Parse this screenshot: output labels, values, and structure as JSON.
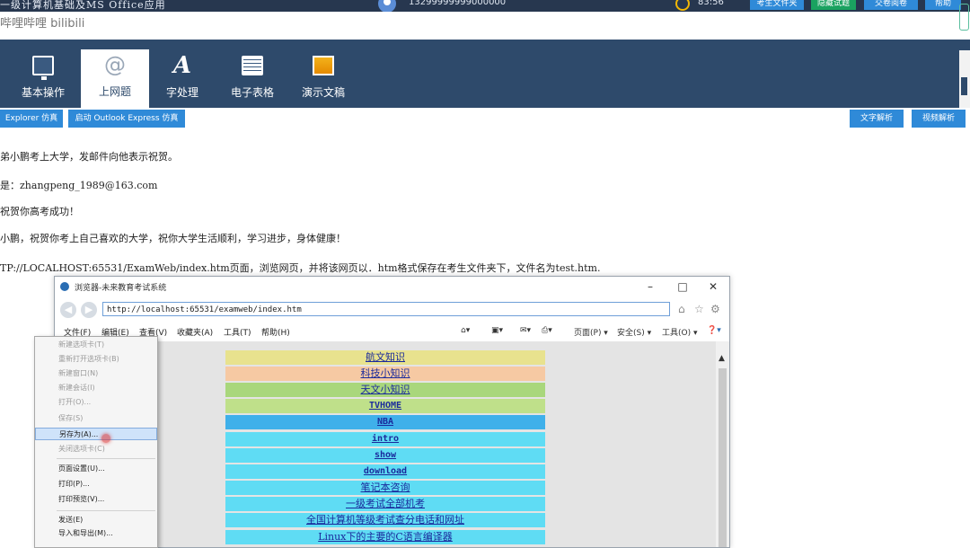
{
  "topbar": {
    "title": "一级计算机基础及MS Office应用",
    "phone": "13299999999000000",
    "time": "83:56",
    "buttons": [
      {
        "label": "考生文件夹",
        "color": "#2f8ad8"
      },
      {
        "label": "隐藏试题",
        "color": "#1aa260"
      },
      {
        "label": "交卷阅卷",
        "color": "#2f8ad8"
      },
      {
        "label": "帮助",
        "color": "#2f8ad8"
      }
    ]
  },
  "watermark": "哔哩哔哩 bilibili",
  "nav": {
    "items": [
      {
        "label": "基本操作",
        "icon": "monitor-icon"
      },
      {
        "label": "上网题",
        "icon": "at-icon",
        "glyph": "@"
      },
      {
        "label": "字处理",
        "icon": "text-a-icon",
        "glyph": "A"
      },
      {
        "label": "电子表格",
        "icon": "spreadsheet-icon"
      },
      {
        "label": "演示文稿",
        "icon": "presentation-icon"
      }
    ]
  },
  "actions": {
    "left": [
      "Explorer 仿真",
      "启动 Outlook Express 仿真"
    ],
    "right": [
      "文字解析",
      "视频解析"
    ]
  },
  "task": {
    "lines": [
      "弟小鹏考上大学，发邮件向他表示祝贺。",
      "是：zhangpeng_1989@163.com",
      "祝贺你高考成功！",
      "小鹏，祝贺你考上自己喜欢的大学，祝你大学生活顺利，学习进步，身体健康！",
      "TP://LOCALHOST:65531/ExamWeb/index.htm页面，浏览网页，并将该网页以．htm格式保存在考生文件夹下，文件名为test.htm."
    ]
  },
  "browser": {
    "title": "浏览器-未来教育考试系统",
    "url": "http://localhost:65531/examweb/index.htm",
    "menu": [
      "文件(F)",
      "编辑(E)",
      "查看(V)",
      "收藏夹(A)",
      "工具(T)",
      "帮助(H)"
    ],
    "commands": [
      "页面(P) ▾",
      "安全(S) ▾",
      "工具(O) ▾"
    ],
    "links": [
      {
        "text": "航文知识",
        "bg": "#e8e28e"
      },
      {
        "text": "科技小知识",
        "bg": "#f6c9a3"
      },
      {
        "text": "天文小知识",
        "bg": "#a9d77c"
      },
      {
        "text": "TVHOME",
        "bg": "#bfe08a"
      },
      {
        "text": "NBA",
        "bg": "#3fb0ea"
      },
      {
        "text": "intro",
        "bg": "#5fdcf4"
      },
      {
        "text": "show",
        "bg": "#5fdcf4"
      },
      {
        "text": "download",
        "bg": "#5fdcf4"
      },
      {
        "text": "笔记本咨询",
        "bg": "#5fdcf4"
      },
      {
        "text": "一级考试全部机考",
        "bg": "#5fdcf4"
      },
      {
        "text": "全国计算机等级考试查分电话和网址",
        "bg": "#5fdcf4"
      },
      {
        "text": "Linux下的主要的C语言编译器",
        "bg": "#5fdcf4"
      }
    ]
  },
  "file_menu": {
    "items": [
      {
        "label": "新建选项卡(T)",
        "state": "disabled"
      },
      {
        "label": "重新打开选项卡(B)",
        "state": "disabled"
      },
      {
        "label": "新建窗口(N)",
        "state": "disabled"
      },
      {
        "label": "新建会话(I)",
        "state": "disabled"
      },
      {
        "label": "打开(O)...",
        "state": "disabled"
      },
      {
        "label": "保存(S)",
        "state": "disabled"
      },
      {
        "label": "另存为(A)...",
        "state": "selected"
      },
      {
        "label": "关闭选项卡(C)",
        "state": "disabled"
      },
      {
        "label": "页面设置(U)...",
        "state": "enabled"
      },
      {
        "label": "打印(P)...",
        "state": "enabled"
      },
      {
        "label": "打印预览(V)...",
        "state": "enabled"
      },
      {
        "label": "发送(E)",
        "state": "enabled"
      },
      {
        "label": "导入和导出(M)...",
        "state": "enabled"
      }
    ]
  }
}
